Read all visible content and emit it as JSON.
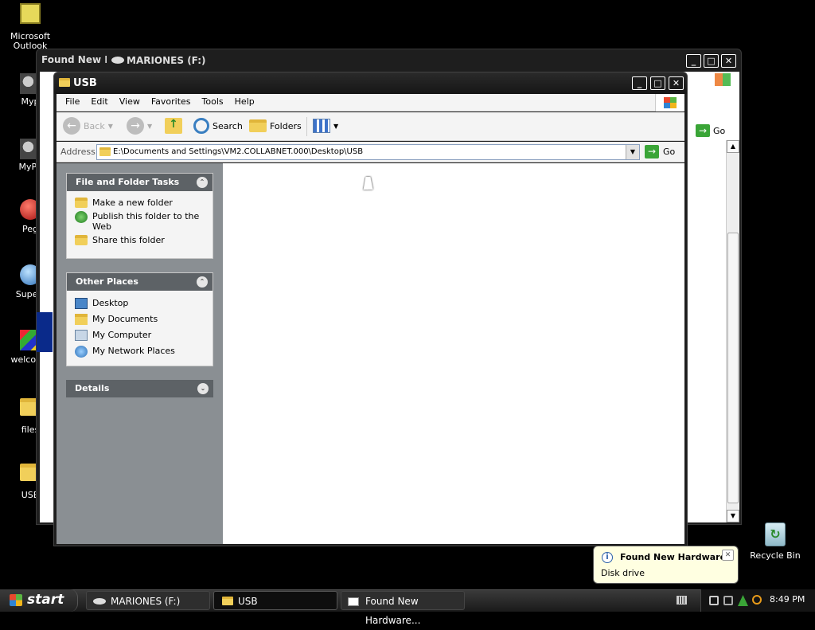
{
  "desktop": {
    "icons": [
      {
        "label": "Microsoft Outlook"
      },
      {
        "label": "Myp"
      },
      {
        "label": "MyPa"
      },
      {
        "label": "Peg"
      },
      {
        "label": "Superr"
      },
      {
        "label": "welcome"
      },
      {
        "label": "files"
      },
      {
        "label": "USB"
      },
      {
        "label": "Recycle Bin"
      }
    ]
  },
  "back_window": {
    "title_left": "Found New H",
    "title": "MARIONES (F:)",
    "go_label": "Go"
  },
  "explorer": {
    "title": "USB",
    "menu": [
      "File",
      "Edit",
      "View",
      "Favorites",
      "Tools",
      "Help"
    ],
    "toolbar": {
      "back_label": "Back",
      "search_label": "Search",
      "folders_label": "Folders"
    },
    "address": {
      "label": "Address",
      "value": "E:\\Documents and Settings\\VM2.COLLABNET.000\\Desktop\\USB",
      "go_label": "Go"
    },
    "tasks": {
      "title": "File and Folder Tasks",
      "items": [
        "Make a new folder",
        "Publish this folder to the Web",
        "Share this folder"
      ]
    },
    "places": {
      "title": "Other Places",
      "items": [
        "Desktop",
        "My Documents",
        "My Computer",
        "My Network Places"
      ]
    },
    "details": {
      "title": "Details"
    }
  },
  "balloon": {
    "title": "Found New Hardware",
    "body": "Disk drive"
  },
  "taskbar": {
    "start": "start",
    "tasks": [
      "MARIONES (F:)",
      "USB",
      "Found New Hardware..."
    ],
    "clock": "8:49 PM"
  },
  "colors": {
    "desktop": "#000000",
    "taskbar": "#252525",
    "title_bar": "#1a1a1a",
    "side_pane": "#8a8f93",
    "panel_header": "#5d6266",
    "start_button": "#2a2a2a"
  }
}
